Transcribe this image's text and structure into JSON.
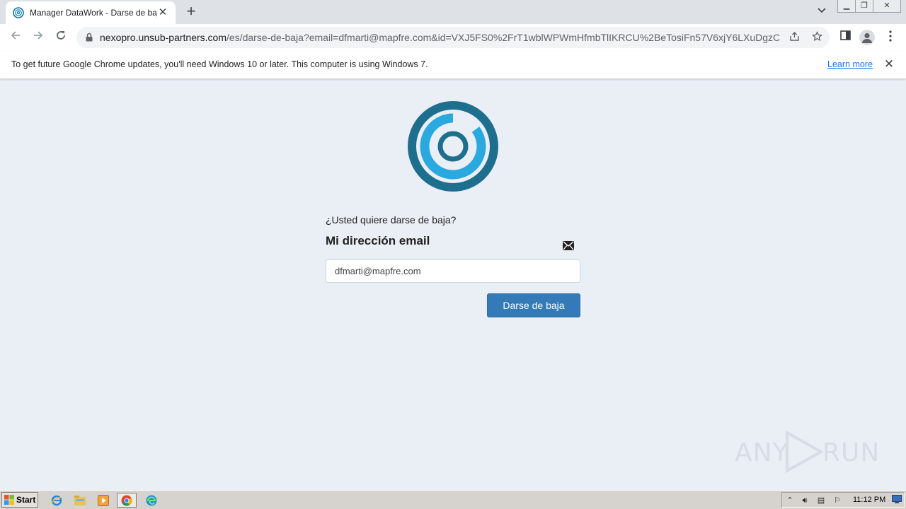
{
  "browser": {
    "tab_title": "Manager DataWork - Darse de baja",
    "url_host": "nexopro.unsub-partners.com",
    "url_path": "/es/darse-de-baja?email=dfmarti@mapfre.com&id=VXJ5FS0%2FrT1wblWPWmHfmbTlIKRCU%2BeTosiFn57V6xjY6LXuDgzCh...",
    "infobar_message": "To get future Google Chrome updates, you'll need Windows 10 or later. This computer is using Windows 7.",
    "infobar_link": "Learn more"
  },
  "page": {
    "question": "¿Usted quiere darse de baja?",
    "email_label": "Mi dirección email",
    "email_value": "dfmarti@mapfre.com",
    "submit_label": "Darse de baja",
    "logo_colors": {
      "dark": "#1e6f8e",
      "light": "#2aa9df"
    }
  },
  "watermark": {
    "left": "ANY",
    "right": "RUN"
  },
  "taskbar": {
    "start_label": "Start",
    "clock": "11:12 PM",
    "apps": [
      "ie-icon",
      "explorer-icon",
      "media-player-icon",
      "chrome-icon",
      "edge-icon"
    ]
  }
}
